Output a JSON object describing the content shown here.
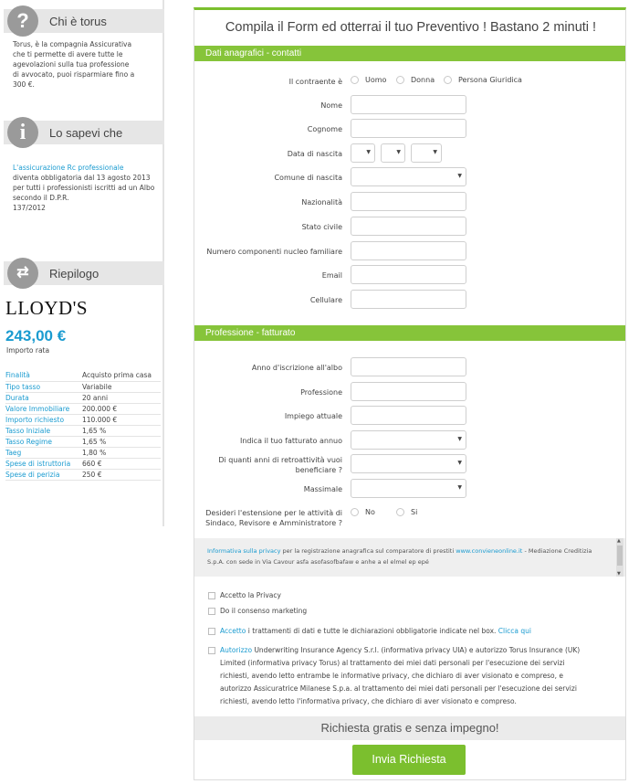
{
  "sidebar": {
    "section1": {
      "icon": "question-icon",
      "title": "Chi è torus",
      "text": [
        "Torus, è la compagnia Assicurativa",
        "che ti permette di avere tutte le",
        "agevolazioni sulla tua professione",
        "di avvocato, puoi risparmiare fino a",
        "300 €."
      ]
    },
    "section2": {
      "icon": "info-icon",
      "title": "Lo sapevi che",
      "link": "L'assicurazione Rc professionale",
      "text": [
        "diventa obbligatoria dal 13 agosto 2013",
        "per tutti i professionisti iscritti ad un Albo",
        "secondo il D.P.R.",
        "137/2012"
      ]
    },
    "section3": {
      "icon": "swap-arrows-icon",
      "title": "Riepilogo"
    },
    "insurer_logo": "LLOYD'S",
    "price": "243,00 €",
    "price_label": "Importo rata",
    "summary": [
      {
        "k": "Finalità",
        "v": "Acquisto prima casa"
      },
      {
        "k": "Tipo tasso",
        "v": "Variabile"
      },
      {
        "k": "Durata",
        "v": "20 anni"
      },
      {
        "k": "Valore Immobiliare",
        "v": "200.000 €"
      },
      {
        "k": "Importo richiesto",
        "v": "110.000 €"
      },
      {
        "k": "Tasso Iniziale",
        "v": "1,65 %"
      },
      {
        "k": "Tasso Regime",
        "v": "1,65 %"
      },
      {
        "k": "Taeg",
        "v": "1,80 %"
      },
      {
        "k": "Spese di istruttoria",
        "v": "660 €"
      },
      {
        "k": "Spese di perizia",
        "v": "250 €"
      }
    ]
  },
  "form": {
    "title": "Compila il Form ed otterrai il tuo Preventivo ! Bastano 2 minuti !",
    "section_personal": "Dati anagrafici - contatti",
    "contraente_label": "Il contraente è",
    "contraente_options": [
      "Uomo",
      "Donna",
      "Persona Giuridica"
    ],
    "fields_personal": [
      "Nome",
      "Cognome",
      "Data di nascita",
      "Comune di nascita",
      "Nazionalità",
      "Stato civile",
      "Numero componenti nucleo familiare",
      "Email",
      "Cellulare"
    ],
    "section_profession": "Professione - fatturato",
    "fields_profession": [
      "Anno d'iscrizione all'albo",
      "Professione",
      "Impiego attuale",
      "Indica il tuo fatturato annuo",
      "Di quanti anni di retroattività vuoi beneficiare ?",
      "Massimale"
    ],
    "extension_label": "Desideri l'estensione per le attività di Sindaco, Revisore e Amministratore ?",
    "extension_options": [
      "No",
      "Si"
    ],
    "privacy": {
      "link": "Informativa sulla privacy",
      "text1": "per la registrazione anagrafica sul comparatore di prestiti",
      "site": "www.convieneonline.it",
      "text2": "- Mediazione Creditizia",
      "text3": "S.p.A. con sede in Via Cavour asfa asofasofbafaw  e anhe a el elmel ep epé"
    },
    "consents": {
      "privacy": "Accetto la Privacy",
      "marketing": "Do il consenso marketing",
      "treat_link": "Accetto",
      "treat_text": "i trattamenti di dati e tutte le dichiarazioni obbligatorie indicate nel box.",
      "treat_click": "Clicca qui",
      "auth_link": "Autorizzo",
      "auth_lines": [
        "Underwriting Insurance Agency S.r.l. (informativa privacy UIA) e autorizzo Torus Insurance (UK)",
        "Limited (informativa privacy Torus) al trattamento dei miei dati personali per l'esecuzione dei servizi",
        "richiesti, avendo letto entrambe le informative privacy, che dichiaro di aver visionato e compreso, e",
        "autorizzo Assicuratrice Milanese S.p.a. al trattamento dei miei dati personali per l'esecuzione dei servizi",
        "richiesti, avendo letto l'informativa privacy, che dichiaro di aver visionato e compreso."
      ]
    },
    "cta_text": "Richiesta gratis e senza impegno!",
    "submit_label": "Invia Richiesta"
  },
  "colors": {
    "accent_green": "#86c43a",
    "link_blue": "#1a9bd0"
  }
}
